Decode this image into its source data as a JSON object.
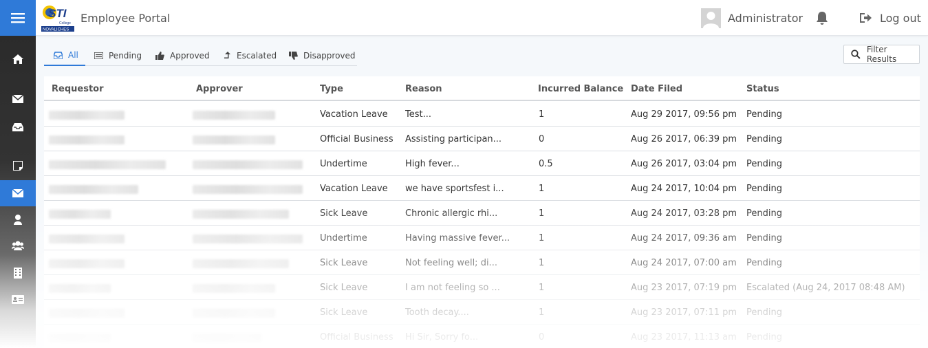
{
  "header": {
    "app_title": "Employee Portal",
    "logo_text": "STI College NOVALICHES",
    "user_name": "Administrator",
    "logout_label": "Log out"
  },
  "sidebar": {
    "items": [
      {
        "icon": "home-icon"
      },
      {
        "icon": "envelope-icon"
      },
      {
        "icon": "inbox-icon"
      },
      {
        "icon": "note-icon"
      },
      {
        "icon": "envelope-icon",
        "active": true
      },
      {
        "icon": "user-icon"
      },
      {
        "icon": "users-icon"
      },
      {
        "icon": "building-icon"
      },
      {
        "icon": "id-card-icon"
      }
    ]
  },
  "tabs": [
    {
      "label": "All",
      "icon": "inbox-icon",
      "active": true
    },
    {
      "label": "Pending",
      "icon": "list-icon"
    },
    {
      "label": "Approved",
      "icon": "thumbs-up-icon"
    },
    {
      "label": "Escalated",
      "icon": "level-up-icon"
    },
    {
      "label": "Disapproved",
      "icon": "thumbs-down-icon"
    }
  ],
  "filter_button": "Filter Results",
  "table": {
    "columns": [
      "Requestor",
      "Approver",
      "Type",
      "Reason",
      "Incurred Balance",
      "Date Filed",
      "Status"
    ],
    "rows": [
      {
        "type": "Vacation Leave",
        "reason": "Test...",
        "balance": "1",
        "date": "Aug 29 2017, 09:56 pm",
        "status": "Pending"
      },
      {
        "type": "Official Business",
        "reason": "Assisting participan...",
        "balance": "0",
        "date": "Aug 26 2017, 06:39 pm",
        "status": "Pending"
      },
      {
        "type": "Undertime",
        "reason": "High fever...",
        "balance": "0.5",
        "date": "Aug 26 2017, 03:04 pm",
        "status": "Pending"
      },
      {
        "type": "Vacation Leave",
        "reason": "we have sportsfest i...",
        "balance": "1",
        "date": "Aug 24 2017, 10:04 pm",
        "status": "Pending"
      },
      {
        "type": "Sick Leave",
        "reason": "Chronic allergic rhi...",
        "balance": "1",
        "date": "Aug 24 2017, 03:28 pm",
        "status": "Pending"
      },
      {
        "type": "Undertime",
        "reason": "Having massive fever...",
        "balance": "1",
        "date": "Aug 24 2017, 09:36 am",
        "status": "Pending"
      },
      {
        "type": "Sick Leave",
        "reason": "Not feeling well; di...",
        "balance": "1",
        "date": "Aug 24 2017, 07:00 am",
        "status": "Pending"
      },
      {
        "type": "Sick Leave",
        "reason": "I am not feeling so ...",
        "balance": "1",
        "date": "Aug 23 2017, 07:19 pm",
        "status": "Escalated (Aug 24, 2017 08:48 AM)"
      },
      {
        "type": "Sick Leave",
        "reason": "Tooth decay....",
        "balance": "1",
        "date": "Aug 23 2017, 07:11 pm",
        "status": "Pending"
      },
      {
        "type": "Official Business",
        "reason": "Hi Sir, Sorry fo...",
        "balance": "0",
        "date": "Aug 23 2017, 11:13 am",
        "status": "Pending"
      }
    ]
  }
}
